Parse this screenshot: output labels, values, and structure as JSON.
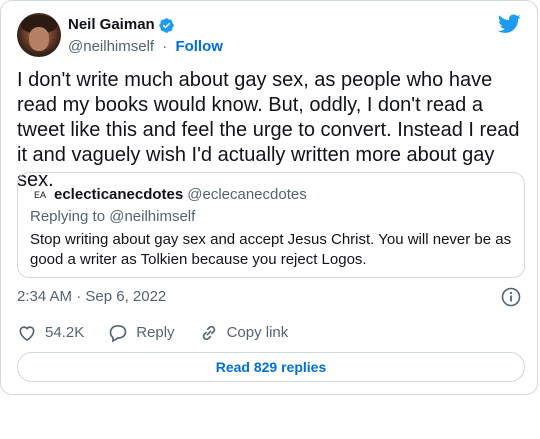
{
  "author": {
    "name": "Neil Gaiman",
    "handle": "@neilhimself",
    "separator": "·",
    "follow_label": "Follow",
    "verified": true
  },
  "icons": {
    "logo": "twitter-bird-icon",
    "verified": "verified-badge-icon",
    "info": "info-icon",
    "like": "heart-icon",
    "reply": "reply-bubble-icon",
    "copy": "link-icon"
  },
  "colors": {
    "accent": "#1d9bf0",
    "link": "#006fd6",
    "muted": "#536471",
    "border": "#cfd9de",
    "text": "#0f1419"
  },
  "tweet": {
    "text": "I don't write much about gay sex, as people who have read my books would know. But, oddly, I don't read a tweet like this and feel the urge to convert. Instead I read it and vaguely wish I'd actually written more about gay sex.",
    "timestamp": "2:34 AM · Sep 6, 2022"
  },
  "quoted": {
    "avatar_text": "EA",
    "name": "eclecticanecdotes",
    "handle": "@eclecanecdotes",
    "replying_to": "Replying to @neilhimself",
    "text": "Stop writing about gay sex and accept Jesus Christ. You will never be as good a writer as Tolkien because you reject Logos."
  },
  "actions": {
    "likes": "54.2K",
    "reply_label": "Reply",
    "copy_label": "Copy link"
  },
  "footer": {
    "read_replies_label": "Read 829 replies"
  }
}
